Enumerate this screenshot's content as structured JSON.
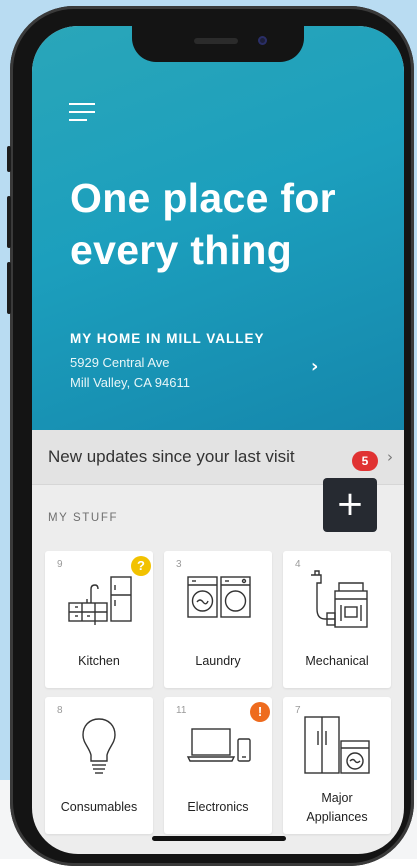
{
  "hero": {
    "title_line1": "One place for",
    "title_line2": "every thing",
    "home_name": "MY HOME IN MILL VALLEY",
    "address_line1": "5929 Central Ave",
    "address_line2": "Mill Valley, CA 94611",
    "chevron": "›"
  },
  "updates": {
    "text": "New updates since your last visit",
    "badge_count": "5",
    "chevron": "›"
  },
  "my_stuff": {
    "label": "MY STUFF",
    "add_symbol": "+"
  },
  "categories": [
    {
      "count": "9",
      "label": "Kitchen",
      "flag": "?",
      "flag_color": "#f2c200",
      "icon": "kitchen-icon"
    },
    {
      "count": "3",
      "label": "Laundry",
      "icon": "laundry-icon"
    },
    {
      "count": "4",
      "label": "Mechanical",
      "icon": "mechanical-icon"
    },
    {
      "count": "8",
      "label": "Consumables",
      "icon": "lightbulb-icon"
    },
    {
      "count": "11",
      "label": "Electronics",
      "flag": "!",
      "flag_color": "#ee6b1e",
      "icon": "electronics-icon"
    },
    {
      "count": "7",
      "label_line1": "Major",
      "label_line2": "Appliances",
      "icon": "major-appliances-icon"
    }
  ],
  "colors": {
    "hero_gradient_start": "#2aa6b9",
    "hero_gradient_end": "#1587ac",
    "badge": "#e03232",
    "add_button": "#262a31"
  }
}
